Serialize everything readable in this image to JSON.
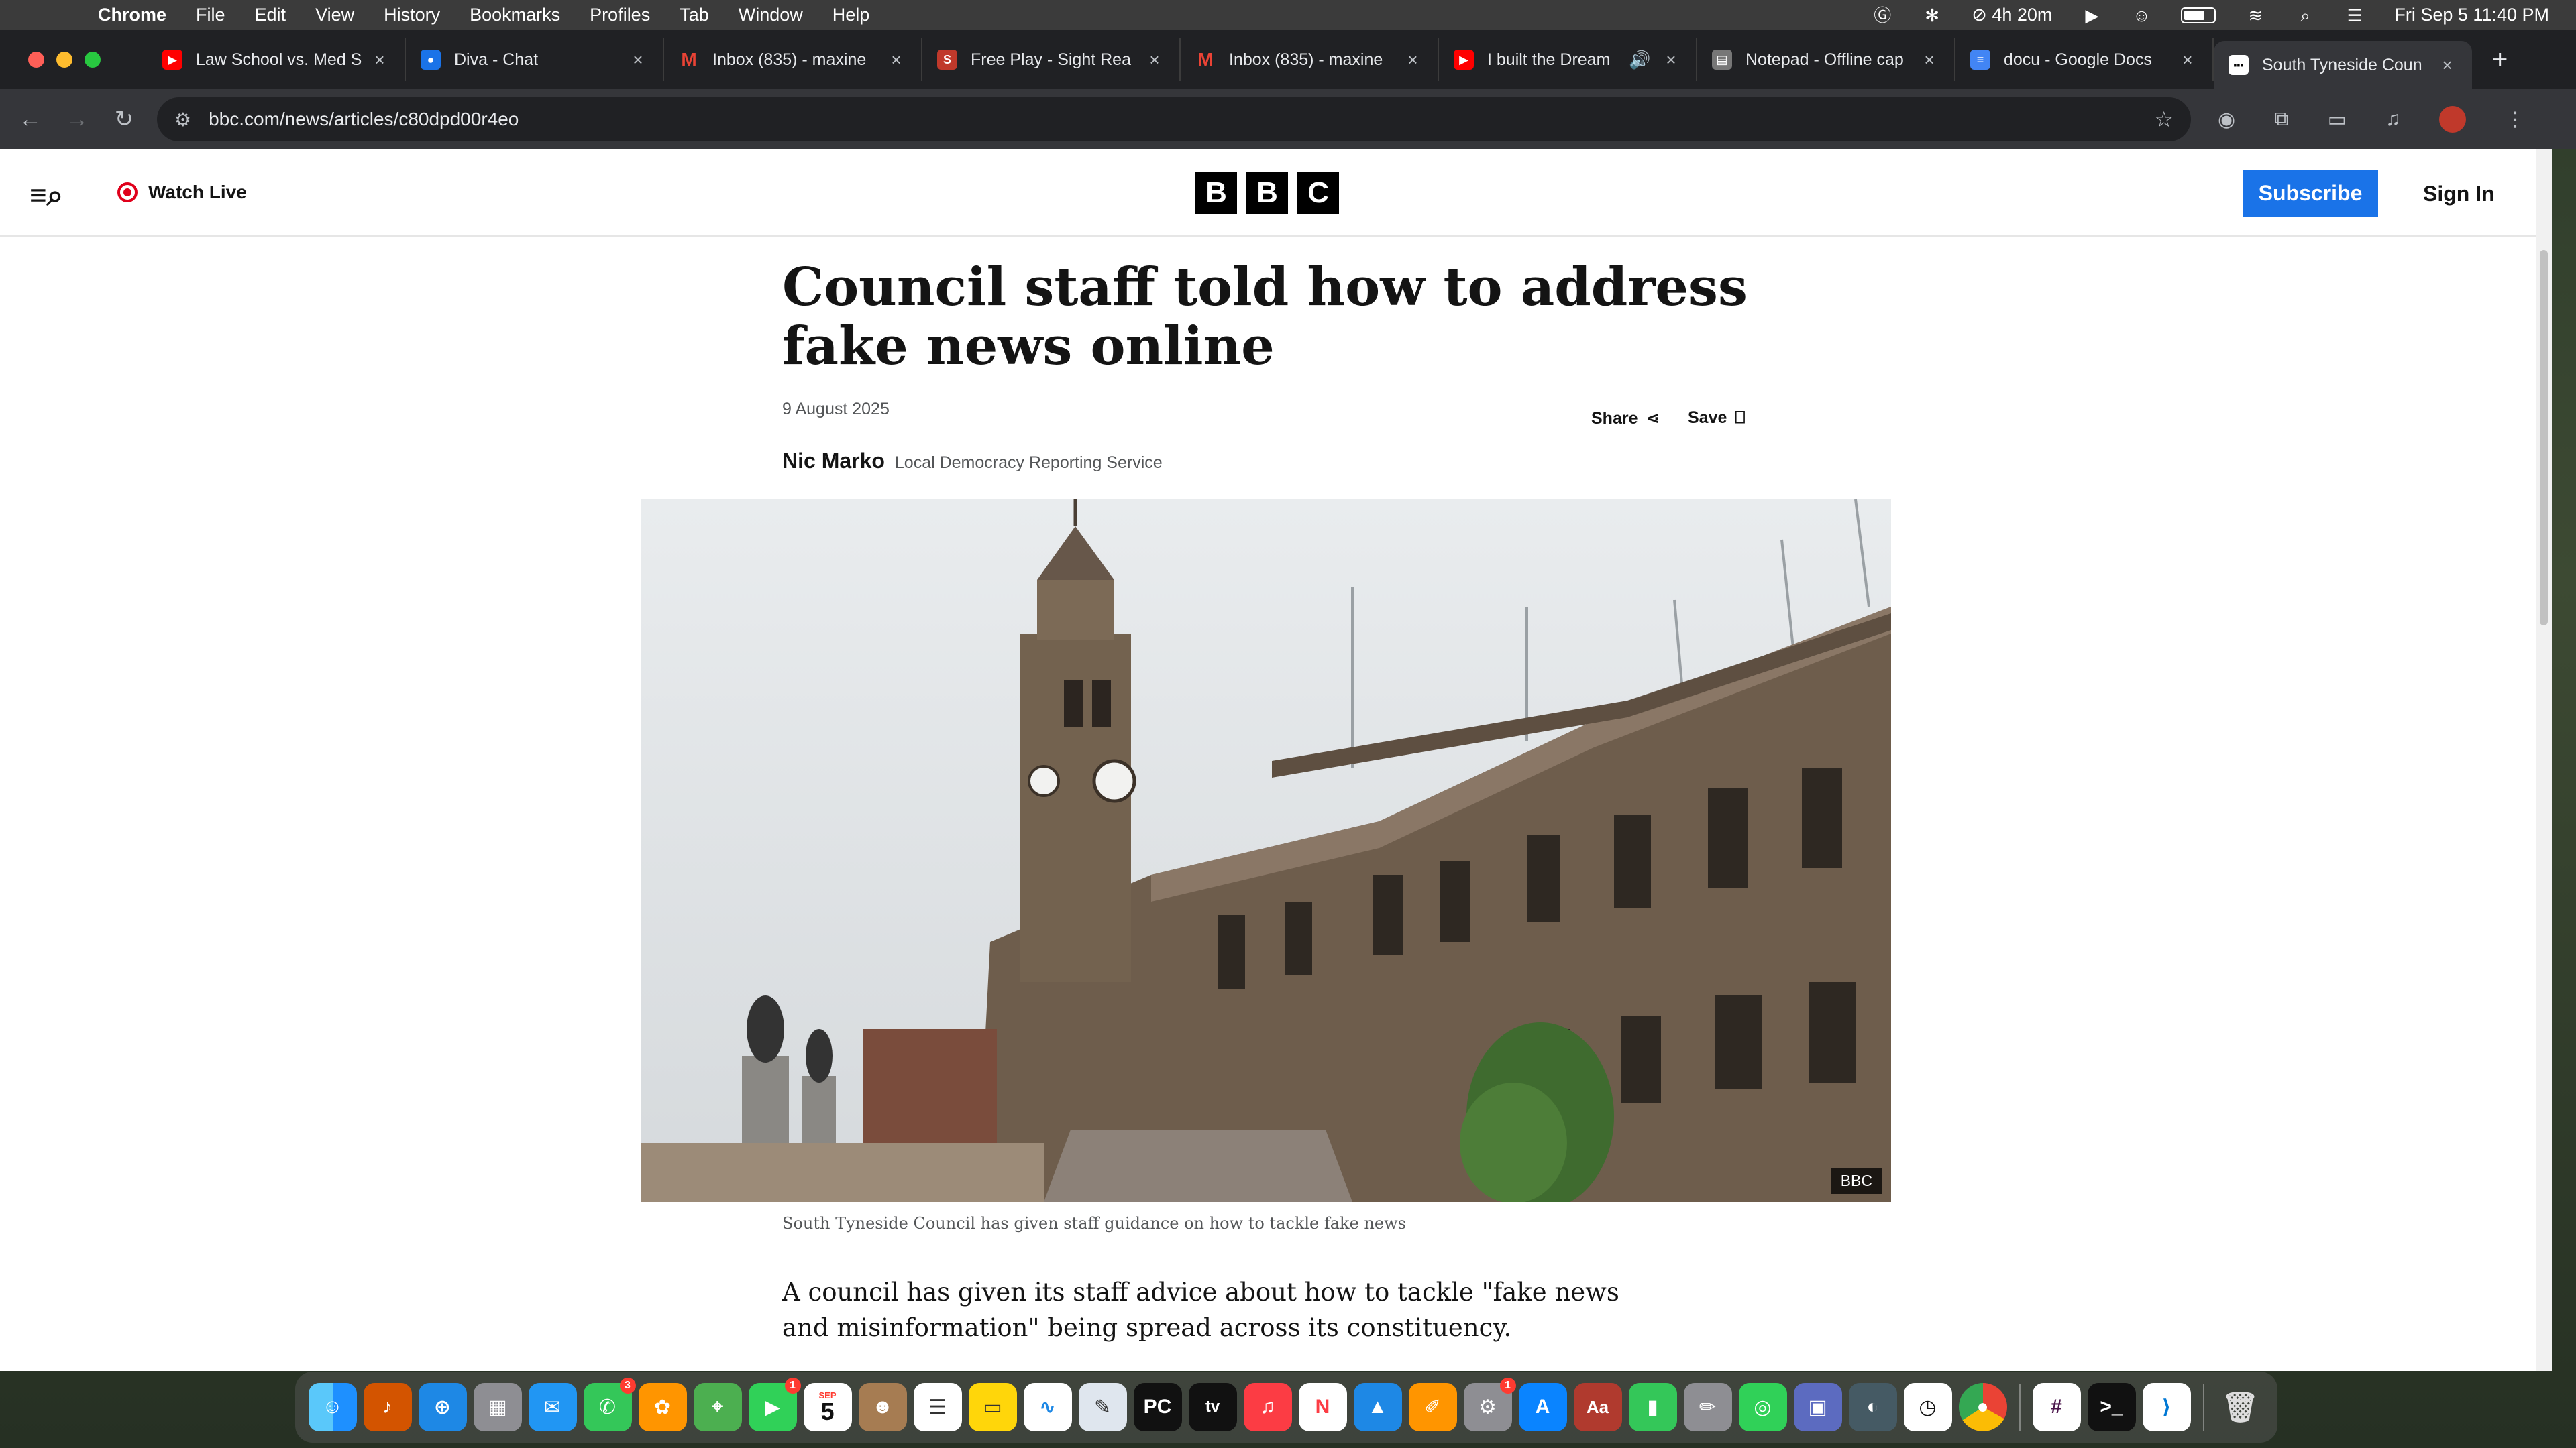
{
  "menubar": {
    "app_name": "Chrome",
    "menus": [
      "File",
      "Edit",
      "View",
      "History",
      "Bookmarks",
      "Profiles",
      "Tab",
      "Window",
      "Help"
    ],
    "battery_time": "4h 20m",
    "datetime": "Fri Sep 5  11:40 PM"
  },
  "tabs": [
    {
      "title": "Law School vs. Med S",
      "favicon": "youtube-icon",
      "color": "#ff0000"
    },
    {
      "title": "Diva - Chat",
      "favicon": "chat-icon",
      "color": "#1a73e8"
    },
    {
      "title": "Inbox (835) - maxine",
      "favicon": "gmail-icon",
      "color": "#ea4335"
    },
    {
      "title": "Free Play - Sight Rea",
      "favicon": "sight-reading-icon",
      "color": "#c0392b"
    },
    {
      "title": "Inbox (835) - maxine",
      "favicon": "gmail-icon",
      "color": "#ea4335"
    },
    {
      "title": "I built the Dream",
      "favicon": "youtube-icon",
      "color": "#ff0000"
    },
    {
      "title": "Notepad - Offline cap",
      "favicon": "notepad-icon",
      "color": "#777777"
    },
    {
      "title": "docu - Google Docs",
      "favicon": "docs-icon",
      "color": "#4285f4"
    },
    {
      "title": "South Tyneside Coun",
      "favicon": "bbc-icon",
      "color": "#ffffff"
    }
  ],
  "toolbar": {
    "url": "bbc.com/news/articles/c80dpd00r4eo"
  },
  "bbc": {
    "watch_live": "Watch Live",
    "logo_letters": [
      "B",
      "B",
      "C"
    ],
    "subscribe": "Subscribe",
    "sign_in": "Sign In"
  },
  "article": {
    "headline": "Council staff told how to address fake news online",
    "date": "9 August 2025",
    "share": "Share",
    "save": "Save",
    "author": "Nic Marko",
    "author_org": "Local Democracy Reporting Service",
    "image_credit": "BBC",
    "caption": "South Tyneside Council has given staff guidance on how to tackle fake news",
    "lede": "A council has given its staff advice about how to tackle \"fake news and misinformation\" being spread across its constituency."
  },
  "dock": {
    "calendar_month": "SEP",
    "calendar_day": "5",
    "messages_badge": "3",
    "facetime_badge": "1",
    "settings_badge": "1",
    "tv_label": "tv"
  }
}
